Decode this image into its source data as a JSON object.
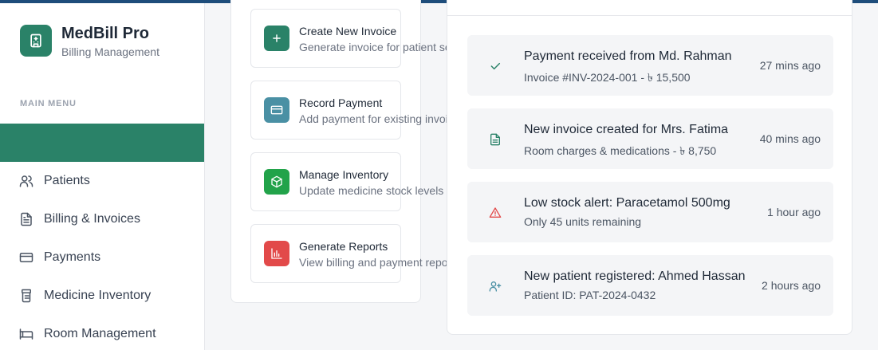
{
  "brand": {
    "title": "MedBill Pro",
    "subtitle": "Billing Management",
    "logo_icon": "hospital-building-icon",
    "accent_color": "#2a8268"
  },
  "sidebar": {
    "heading": "MAIN MENU",
    "items": [
      {
        "label": "",
        "icon": "dashboard-icon",
        "active": true
      },
      {
        "label": "Patients",
        "icon": "users-icon"
      },
      {
        "label": "Billing & Invoices",
        "icon": "file-text-icon"
      },
      {
        "label": "Payments",
        "icon": "credit-card-icon"
      },
      {
        "label": "Medicine Inventory",
        "icon": "pill-bottle-icon"
      },
      {
        "label": "Room Management",
        "icon": "bed-icon"
      }
    ]
  },
  "quick_actions": [
    {
      "title": "Create New Invoice",
      "desc": "Generate invoice for patient se",
      "icon": "plus-icon",
      "color": "#2a8268"
    },
    {
      "title": "Record Payment",
      "desc": "Add payment for existing invoi",
      "icon": "credit-card-icon",
      "color": "#4a90a4"
    },
    {
      "title": "Manage Inventory",
      "desc": "Update medicine stock levels",
      "icon": "package-icon",
      "color": "#22a34a"
    },
    {
      "title": "Generate Reports",
      "desc": "View billing and payment repo",
      "icon": "bar-chart-icon",
      "color": "#e24a4a"
    }
  ],
  "activity": [
    {
      "title": "Payment received from Md. Rahman",
      "sub": "Invoice #INV-2024-001 - ৳ 15,500",
      "time": "27 mins ago",
      "icon": "check-icon",
      "color": "#2a8268"
    },
    {
      "title": "New invoice created for Mrs. Fatima",
      "sub": "Room charges & medications - ৳ 8,750",
      "time": "40 mins ago",
      "icon": "file-text-icon",
      "color": "#2a8268"
    },
    {
      "title": "Low stock alert: Paracetamol 500mg",
      "sub": "Only 45 units remaining",
      "time": "1 hour ago",
      "icon": "alert-triangle-icon",
      "color": "#e24a4a"
    },
    {
      "title": "New patient registered: Ahmed Hassan",
      "sub": "Patient ID: PAT-2024-0432",
      "time": "2 hours ago",
      "icon": "user-plus-icon",
      "color": "#4a90a4"
    }
  ]
}
